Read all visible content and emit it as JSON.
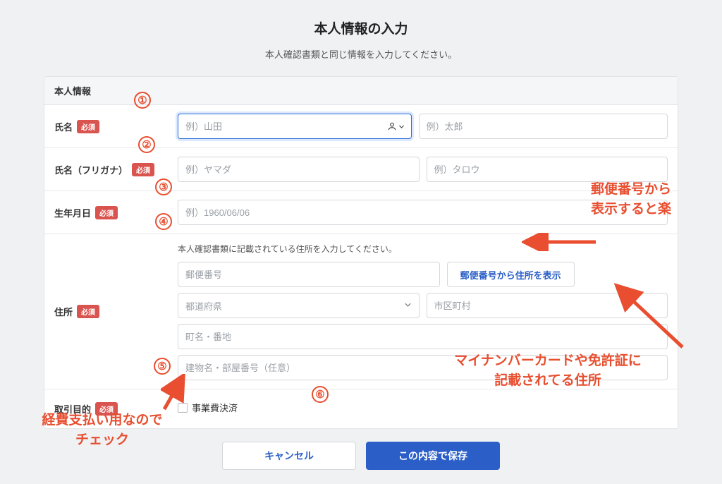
{
  "page": {
    "title": "本人情報の入力",
    "subtitle": "本人確認書類と同じ情報を入力してください。"
  },
  "section": {
    "header": "本人情報"
  },
  "labels": {
    "name": "氏名",
    "name_kana": "氏名（フリガナ）",
    "birthdate": "生年月日",
    "address": "住所",
    "purpose": "取引目的",
    "required": "必須"
  },
  "placeholders": {
    "family_name": "例）山田",
    "given_name": "例）太郎",
    "family_kana": "例）ヤマダ",
    "given_kana": "例）タロウ",
    "birthdate": "例）1960/06/06",
    "postal": "郵便番号",
    "prefecture": "都道府県",
    "city": "市区町村",
    "street": "町名・番地",
    "building": "建物名・部屋番号（任意）"
  },
  "helpers": {
    "address_note": "本人確認書類に記載されている住所を入力してください。"
  },
  "buttons": {
    "lookup_postal": "郵便番号から住所を表示",
    "cancel": "キャンセル",
    "save": "この内容で保存"
  },
  "checkbox": {
    "business_expense": "事業費決済"
  },
  "annotations": {
    "n1": "①",
    "n2": "②",
    "n3": "③",
    "n4": "④",
    "n5": "⑤",
    "n6": "⑥",
    "postal_tip_line1": "郵便番号から",
    "postal_tip_line2": "表示すると楽",
    "address_tip_line1": "マイナンバーカードや免許証に",
    "address_tip_line2": "記載されてる住所",
    "checkbox_tip_line1": "経費支払い用なので",
    "checkbox_tip_line2": "チェック"
  }
}
